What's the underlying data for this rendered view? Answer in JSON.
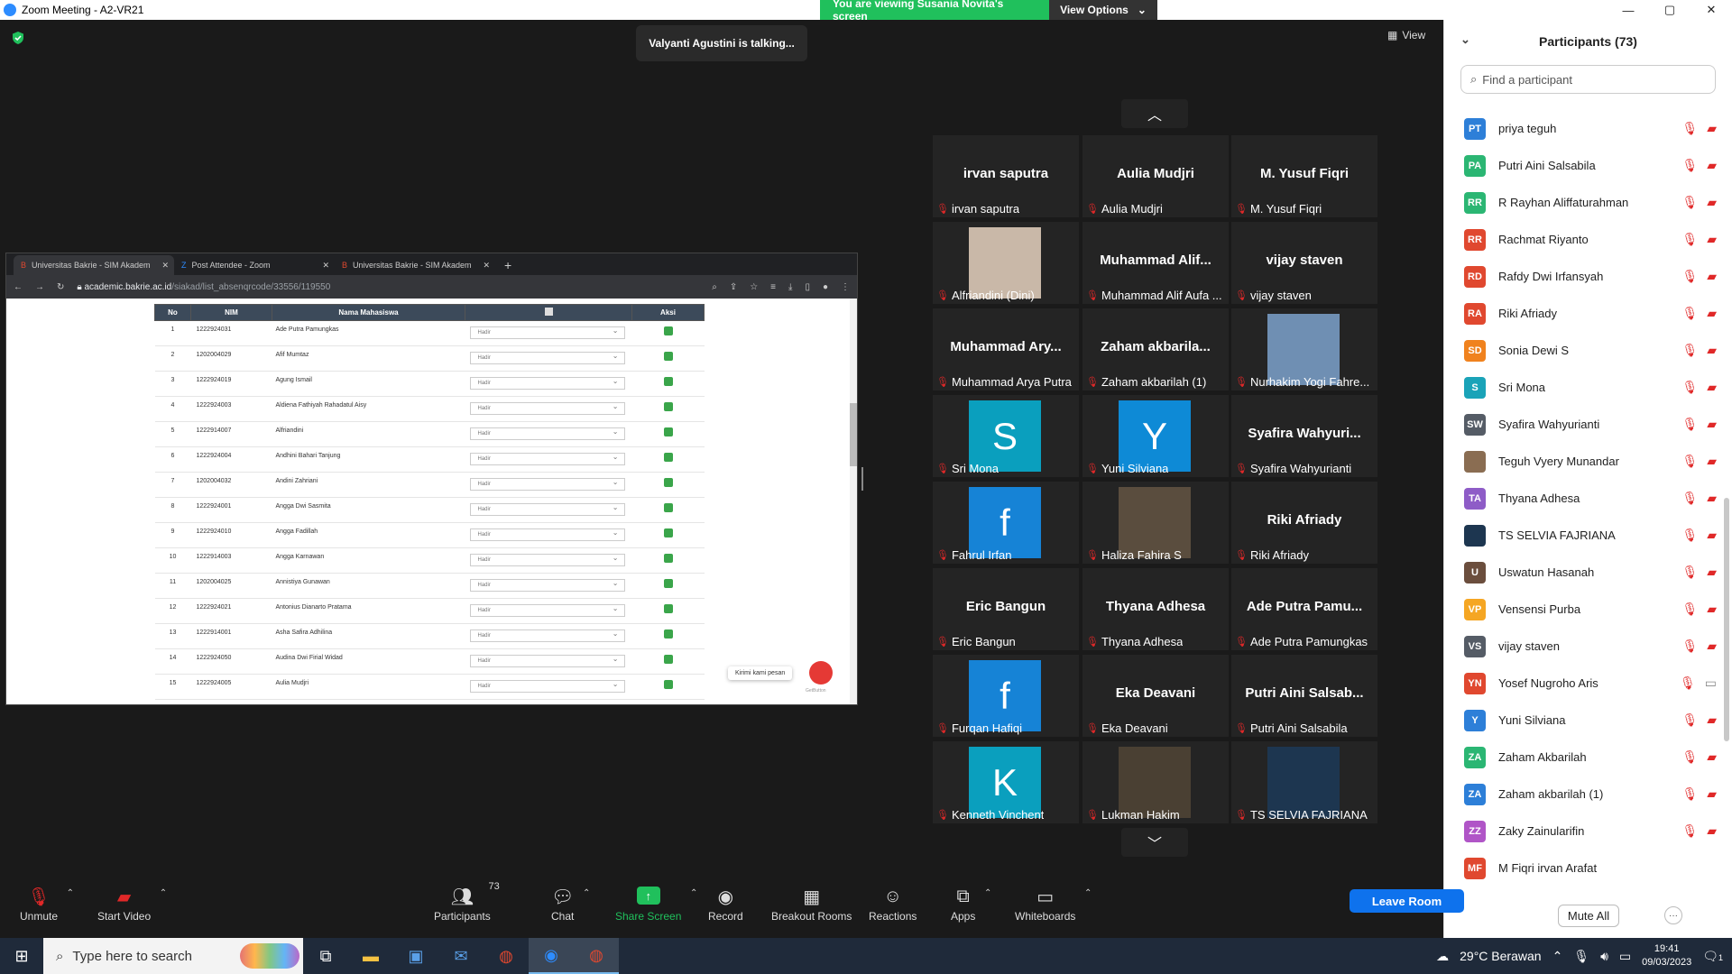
{
  "window": {
    "title": "Zoom Meeting - A2-VR21",
    "controls": [
      "—",
      "▢",
      "✕"
    ]
  },
  "banner": {
    "message": "You are viewing Susania Novita's screen",
    "options_label": "View Options"
  },
  "meeting": {
    "talking_indicator": "Valyanti Agustini is talking...",
    "view_label": "View"
  },
  "shared_screen": {
    "tabs": [
      {
        "label": "Universitas Bakrie - SIM Akadem",
        "active": true
      },
      {
        "label": "Post Attendee - Zoom",
        "active": false
      },
      {
        "label": "Universitas Bakrie - SIM Akadem",
        "active": false
      }
    ],
    "url_host": "academic.bakrie.ac.id",
    "url_path": "/siakad/list_absenqrcode/33556/119550",
    "table_headers": [
      "No",
      "NIM",
      "Nama Mahasiswa",
      "",
      "Aksi"
    ],
    "rows": [
      {
        "no": "1",
        "nim": "1222924031",
        "nama": "Ade Putra Pamungkas",
        "status": "Hadir"
      },
      {
        "no": "2",
        "nim": "1202004029",
        "nama": "Afif Mumtaz",
        "status": "Hadir"
      },
      {
        "no": "3",
        "nim": "1222924019",
        "nama": "Agung Ismail",
        "status": "Hadir"
      },
      {
        "no": "4",
        "nim": "1222924003",
        "nama": "Aldiena Fathiyah Rahadatul Aisy",
        "status": "Hadir"
      },
      {
        "no": "5",
        "nim": "1222914007",
        "nama": "Alfriandini",
        "status": "Hadir"
      },
      {
        "no": "6",
        "nim": "1222924004",
        "nama": "Andhini Bahari Tanjung",
        "status": "Hadir"
      },
      {
        "no": "7",
        "nim": "1202004032",
        "nama": "Andini Zahriani",
        "status": "Hadir"
      },
      {
        "no": "8",
        "nim": "1222924001",
        "nama": "Angga Dwi Sasmita",
        "status": "Hadir"
      },
      {
        "no": "9",
        "nim": "1222924010",
        "nama": "Angga Fadillah",
        "status": "Hadir"
      },
      {
        "no": "10",
        "nim": "1222914003",
        "nama": "Angga Karnawan",
        "status": "Hadir"
      },
      {
        "no": "11",
        "nim": "1202004025",
        "nama": "Annistiya Gunawan",
        "status": "Hadir"
      },
      {
        "no": "12",
        "nim": "1222924021",
        "nama": "Antonius Dianarto Pratama",
        "status": "Hadir"
      },
      {
        "no": "13",
        "nim": "1222914001",
        "nama": "Asha Safira Adhilina",
        "status": "Hadir"
      },
      {
        "no": "14",
        "nim": "1222924050",
        "nama": "Audina Dwi Firial Widad",
        "status": "Hadir"
      },
      {
        "no": "15",
        "nim": "1222924005",
        "nama": "Aulia Mudjri",
        "status": "Hadir"
      }
    ],
    "chat_widget_text": "Kirimi kami pesan",
    "chat_widget_brand": "GetButton"
  },
  "gallery": [
    {
      "big": "irvan saputra",
      "label": "irvan saputra",
      "type": "name"
    },
    {
      "big": "Aulia Mudjri",
      "label": "Aulia Mudjri",
      "type": "name"
    },
    {
      "big": "M. Yusuf Fiqri",
      "label": "M. Yusuf Fiqri",
      "type": "name"
    },
    {
      "big": "",
      "label": "Alfriandini (Dini)",
      "type": "photo",
      "color": "#c9b8a8"
    },
    {
      "big": "Muhammad Alif...",
      "label": "Muhammad Alif Aufa ...",
      "type": "name"
    },
    {
      "big": "vijay staven",
      "label": "vijay staven",
      "type": "name"
    },
    {
      "big": "Muhammad Ary...",
      "label": "Muhammad Arya Putra",
      "type": "name"
    },
    {
      "big": "Zaham akbarila...",
      "label": "Zaham akbarilah (1)",
      "type": "name"
    },
    {
      "big": "",
      "label": "Nurhakim Yogi Fahre...",
      "type": "photo",
      "color": "#6f8fb3"
    },
    {
      "big": "S",
      "label": "Sri Mona",
      "type": "letter",
      "color": "#0a9fbe"
    },
    {
      "big": "Y",
      "label": "Yuni Silviana",
      "type": "letter",
      "color": "#0e8ad6"
    },
    {
      "big": "Syafira Wahyuri...",
      "label": "Syafira Wahyurianti",
      "type": "name"
    },
    {
      "big": "f",
      "label": "Fahrul Irfan",
      "type": "letter",
      "color": "#1683d6"
    },
    {
      "big": "",
      "label": "Haliza Fahira S",
      "type": "photo",
      "color": "#5a4d3e"
    },
    {
      "big": "Riki Afriady",
      "label": "Riki Afriady",
      "type": "name"
    },
    {
      "big": "Eric Bangun",
      "label": "Eric Bangun",
      "type": "name"
    },
    {
      "big": "Thyana Adhesa",
      "label": "Thyana Adhesa",
      "type": "name"
    },
    {
      "big": "Ade Putra Pamu...",
      "label": "Ade Putra Pamungkas",
      "type": "name"
    },
    {
      "big": "f",
      "label": "Furqan Hafiqi",
      "type": "letter",
      "color": "#1683d6"
    },
    {
      "big": "Eka Deavani",
      "label": "Eka Deavani",
      "type": "name"
    },
    {
      "big": "Putri Aini Salsab...",
      "label": "Putri Aini Salsabila",
      "type": "name"
    },
    {
      "big": "K",
      "label": "Kenneth Vinchent",
      "type": "letter",
      "color": "#0a9fbe"
    },
    {
      "big": "",
      "label": "Lukman Hakim",
      "type": "photo",
      "color": "#4a4033"
    },
    {
      "big": "",
      "label": "TS SELVIA FAJRIANA",
      "type": "photo",
      "color": "#1d3650"
    }
  ],
  "participants_panel": {
    "title": "Participants (73)",
    "search_placeholder": "Find a participant",
    "mute_all_label": "Mute All",
    "more_label": "···",
    "list": [
      {
        "initials": "PT",
        "name": "priya teguh",
        "color": "#2d7fd8",
        "video": "off"
      },
      {
        "initials": "PA",
        "name": "Putri Aini Salsabila",
        "color": "#2bb673",
        "video": "off"
      },
      {
        "initials": "RR",
        "name": "R Rayhan Aliffaturahman",
        "color": "#2bb673",
        "video": "off"
      },
      {
        "initials": "RR",
        "name": "Rachmat Riyanto",
        "color": "#e0482f",
        "video": "off"
      },
      {
        "initials": "RD",
        "name": "Rafdy Dwi Irfansyah",
        "color": "#e0482f",
        "video": "off"
      },
      {
        "initials": "RA",
        "name": "Riki Afriady",
        "color": "#e0482f",
        "video": "off"
      },
      {
        "initials": "SD",
        "name": "Sonia Dewi S",
        "color": "#f0821e",
        "video": "off"
      },
      {
        "initials": "S",
        "name": "Sri Mona",
        "color": "#1aa3b8",
        "video": "off"
      },
      {
        "initials": "SW",
        "name": "Syafira Wahyurianti",
        "color": "#555c66",
        "video": "off"
      },
      {
        "initials": "",
        "name": "Teguh Vyery Munandar",
        "color": "#8a6d52",
        "video": "off"
      },
      {
        "initials": "TA",
        "name": "Thyana Adhesa",
        "color": "#8e5cc7",
        "video": "off"
      },
      {
        "initials": "",
        "name": "TS SELVIA FAJRIANA",
        "color": "#1d3650",
        "video": "off"
      },
      {
        "initials": "U",
        "name": "Uswatun Hasanah",
        "color": "#6b4e3d",
        "video": "off"
      },
      {
        "initials": "VP",
        "name": "Vensensi Purba",
        "color": "#f5a623",
        "video": "off"
      },
      {
        "initials": "VS",
        "name": "vijay staven",
        "color": "#555c66",
        "video": "off"
      },
      {
        "initials": "YN",
        "name": "Yosef Nugroho Aris",
        "color": "#e0482f",
        "video": "on"
      },
      {
        "initials": "Y",
        "name": "Yuni Silviana",
        "color": "#2d7fd8",
        "video": "off"
      },
      {
        "initials": "ZA",
        "name": "Zaham Akbarilah",
        "color": "#2bb673",
        "video": "off"
      },
      {
        "initials": "ZA",
        "name": "Zaham akbarilah (1)",
        "color": "#2d7fd8",
        "video": "off"
      },
      {
        "initials": "ZZ",
        "name": "Zaky Zainularifin",
        "color": "#b055c7",
        "video": "off"
      },
      {
        "initials": "MF",
        "name": "M Fiqri irvan Arafat",
        "color": "#e0482f",
        "video": "none"
      }
    ]
  },
  "toolbar": {
    "unmute": "Unmute",
    "start_video": "Start Video",
    "participants": "Participants",
    "participants_count": "73",
    "chat": "Chat",
    "share_screen": "Share Screen",
    "record": "Record",
    "breakout_rooms": "Breakout Rooms",
    "reactions": "Reactions",
    "apps": "Apps",
    "whiteboards": "Whiteboards",
    "leave_room": "Leave Room"
  },
  "taskbar": {
    "search_placeholder": "Type here to search",
    "weather": "29°C  Berawan",
    "time": "19:41",
    "date": "09/03/2023",
    "notifications": "1"
  },
  "colors": {
    "zoom_blue": "#0e72ed",
    "share_green": "#20c05c",
    "mute_red": "#e02828"
  }
}
